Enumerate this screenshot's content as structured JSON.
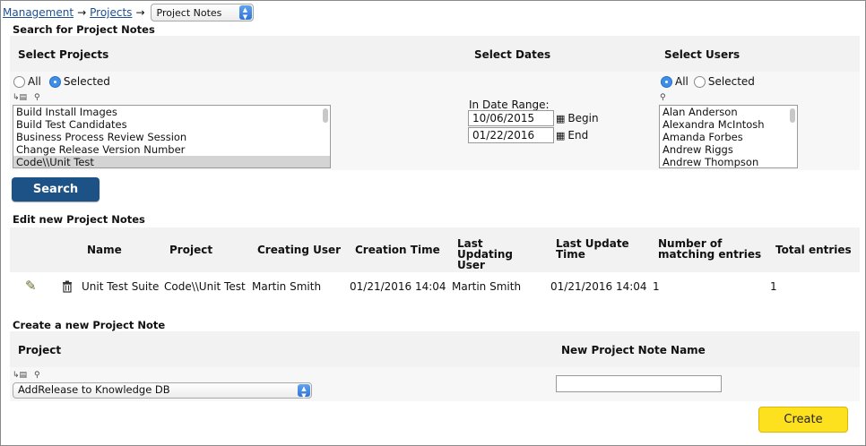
{
  "breadcrumb": {
    "items": [
      "Management",
      "Projects"
    ],
    "separator": "→",
    "current": "Project Notes"
  },
  "search": {
    "title": "Search for Project Notes",
    "projects": {
      "label": "Select Projects",
      "radio_all": "All",
      "radio_selected": "Selected",
      "selected_mode": "Selected",
      "items": [
        "Build Install Images",
        "Build Test Candidates",
        "Business Process Review Session",
        "Change Release Version Number",
        "Code\\\\Unit Test"
      ],
      "selected_item": "Code\\\\Unit Test"
    },
    "dates": {
      "label": "Select Dates",
      "range_label": "In Date Range:",
      "begin_value": "10/06/2015",
      "begin_label": "Begin",
      "end_value": "01/22/2016",
      "end_label": "End"
    },
    "users": {
      "label": "Select Users",
      "radio_all": "All",
      "radio_selected": "Selected",
      "selected_mode": "All",
      "items": [
        "Alan Anderson",
        "Alexandra McIntosh",
        "Amanda Forbes",
        "Andrew Riggs",
        "Andrew Thompson"
      ]
    },
    "button": "Search"
  },
  "edit": {
    "title": "Edit new Project Notes",
    "columns": {
      "name": "Name",
      "project": "Project",
      "creating_user": "Creating User",
      "creation_time": "Creation Time",
      "last_updating_user": "Last Updating User",
      "last_update_time": "Last Update Time",
      "matching": "Number of matching entries",
      "total": "Total entries"
    },
    "row": {
      "name": "Unit Test Suite",
      "project": "Code\\\\Unit Test",
      "creating_user": "Martin Smith",
      "creation_time": "01/21/2016 14:04",
      "last_updating_user": "Martin Smith",
      "last_update_time": "01/21/2016 14:04",
      "matching": "1",
      "total": "1"
    }
  },
  "create": {
    "title": "Create a new Project Note",
    "project_label": "Project",
    "name_label": "New Project Note Name",
    "project_value": "AddRelease to Knowledge DB",
    "name_value": "",
    "button": "Create"
  },
  "colors": {
    "link": "#1f4f8f",
    "search_button": "#1d5286",
    "create_button": "#fde11f",
    "band": "#f2f2f2"
  },
  "icons": [
    "tree-select-icon",
    "magnifier-icon",
    "calendar-icon",
    "edit-pencil-icon",
    "trash-icon",
    "select-arrows-icon"
  ]
}
